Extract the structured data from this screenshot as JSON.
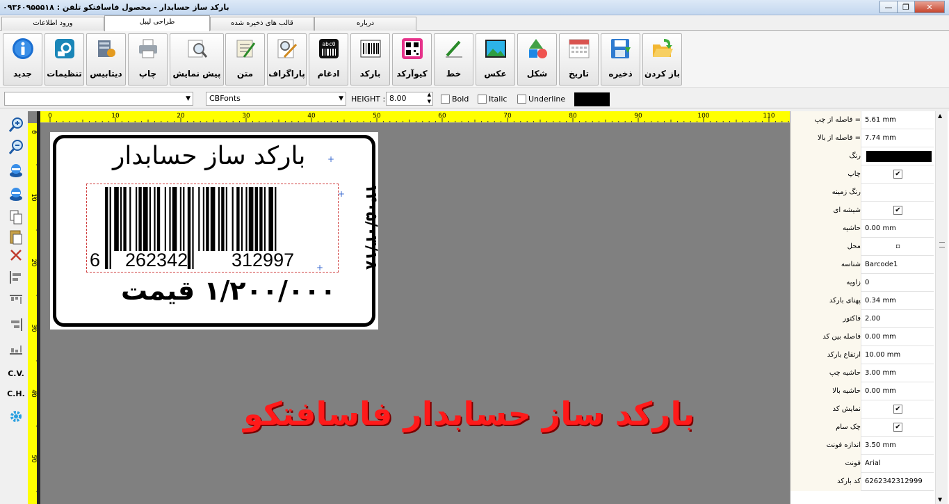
{
  "window": {
    "title": "بارکد ساز حسابدار - محصول فاسافتکو  تلفن : ۰۹۳۶۰۹۵۵۵۱۸",
    "controls": {
      "minimize": "—",
      "maximize": "❐",
      "close": "✕"
    }
  },
  "tabs": [
    {
      "label": "ورود اطلاعات"
    },
    {
      "label": "طراحی لیبل"
    },
    {
      "label": "قالب های ذخیره شده"
    },
    {
      "label": "درباره"
    }
  ],
  "toolbar": {
    "buttons": [
      {
        "label": "جدید",
        "icon": "info-icon"
      },
      {
        "label": "تنظیمات",
        "icon": "settings-icon"
      },
      {
        "label": "دیتابیس",
        "icon": "database-icon"
      },
      {
        "label": "چاپ",
        "icon": "printer-icon"
      },
      {
        "label": "پیش نمایش",
        "icon": "preview-icon"
      },
      {
        "label": "متن",
        "icon": "text-icon"
      },
      {
        "label": "پاراگراف",
        "icon": "paragraph-icon"
      },
      {
        "label": "ادغام",
        "icon": "merge-icon"
      },
      {
        "label": "بارکد",
        "icon": "barcode-icon"
      },
      {
        "label": "کیوآرکد",
        "icon": "qrcode-icon"
      },
      {
        "label": "خط",
        "icon": "line-icon"
      },
      {
        "label": "عکس",
        "icon": "image-icon"
      },
      {
        "label": "شکل",
        "icon": "shape-icon"
      },
      {
        "label": "تاریخ",
        "icon": "calendar-icon"
      },
      {
        "label": "ذخیره",
        "icon": "save-icon"
      },
      {
        "label": "باز کردن",
        "icon": "open-folder-icon"
      }
    ]
  },
  "fontbar": {
    "object_select": "",
    "font_name": "CBFonts",
    "height_label": "HEIGHT :",
    "height_value": "8.00",
    "bold_label": "Bold",
    "italic_label": "Italic",
    "underline_label": "Underline",
    "color": "#000000"
  },
  "left_tools": {
    "cv_label": "C.V.",
    "ch_label": "C.H."
  },
  "ruler": {
    "h_labels": [
      "0",
      "10",
      "20",
      "30",
      "40",
      "50",
      "60",
      "70",
      "80",
      "90",
      "100",
      "110"
    ],
    "v_labels": [
      "0",
      "10",
      "20",
      "30",
      "40",
      "50"
    ]
  },
  "label": {
    "title": "بارکد ساز حسابدار",
    "barcode_left_digit": "6",
    "barcode_group1": "262342",
    "barcode_group2": "312997",
    "date": "۱۴۰۵/۰۳/۱۸",
    "price": "۱/۲۰۰/۰۰۰ قیمت"
  },
  "watermark": "بارکد ساز حسابدار فاسافتکو",
  "properties": [
    {
      "name": "= فاصله از چپ",
      "value": "5.61 mm"
    },
    {
      "name": "= فاصله از بالا",
      "value": "7.74 mm"
    },
    {
      "name": "رنگ",
      "value": "",
      "swatch": "#000000"
    },
    {
      "name": "چاپ",
      "value": "✔",
      "check": true
    },
    {
      "name": "رنگ زمینه",
      "value": ""
    },
    {
      "name": "شیشه ای",
      "value": "✔",
      "check": true
    },
    {
      "name": "حاشیه",
      "value": "0.00 mm"
    },
    {
      "name": "محل",
      "value": "▫"
    },
    {
      "name": "شناسه",
      "value": "Barcode1"
    },
    {
      "name": "زاویه",
      "value": "0"
    },
    {
      "name": "پهنای بارکد",
      "value": "0.34 mm"
    },
    {
      "name": "فاکتور",
      "value": "2.00"
    },
    {
      "name": "فاصله بین کد",
      "value": "0.00 mm"
    },
    {
      "name": "ارتفاع بارکد",
      "value": "10.00 mm"
    },
    {
      "name": "حاشیه چپ",
      "value": "3.00 mm"
    },
    {
      "name": "حاشیه بالا",
      "value": "0.00 mm"
    },
    {
      "name": "نمایش کد",
      "value": "✔",
      "check": true
    },
    {
      "name": "چک سام",
      "value": "✔",
      "check": true
    },
    {
      "name": "اندازه فونت",
      "value": "3.50 mm"
    },
    {
      "name": "فونت",
      "value": "Arial"
    },
    {
      "name": "کد بارکد",
      "value": "6262342312999"
    }
  ]
}
